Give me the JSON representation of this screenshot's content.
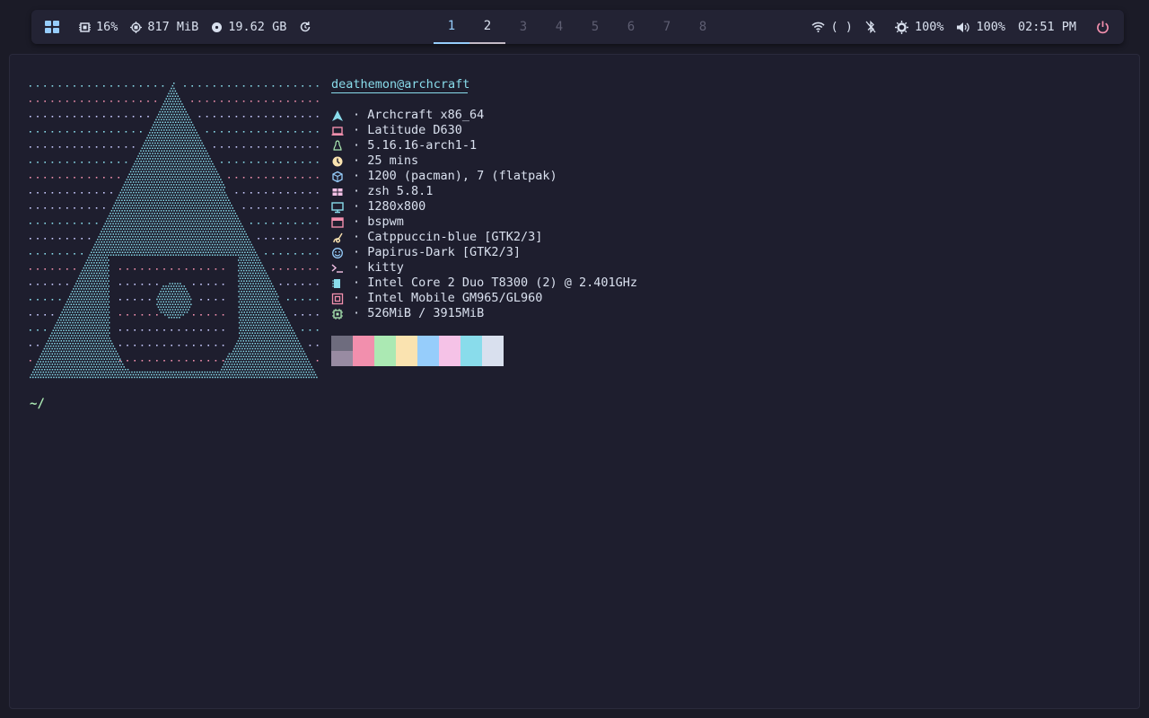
{
  "topbar": {
    "launcher_icon": "grid-icon",
    "cpu": "16%",
    "memory": "817 MiB",
    "disk": "19.62 GB",
    "workspaces": [
      "1",
      "2",
      "3",
      "4",
      "5",
      "6",
      "7",
      "8"
    ],
    "active_workspace": "1",
    "network": "( )",
    "brightness": "100%",
    "volume": "100%",
    "clock": "02:51 PM"
  },
  "terminal": {
    "user_host": "deathemon@archcraft",
    "info": [
      {
        "icon": "arch-logo-icon",
        "color": "#89dceb",
        "value": "Archcraft x86_64"
      },
      {
        "icon": "laptop-icon",
        "color": "#f28fad",
        "value": "Latitude D630"
      },
      {
        "icon": "linux-penguin-icon",
        "color": "#abe9b3",
        "value": "5.16.16-arch1-1"
      },
      {
        "icon": "clock-icon",
        "color": "#fae3b0",
        "value": "25 mins"
      },
      {
        "icon": "package-icon",
        "color": "#96cdfb",
        "value": "1200 (pacman), 7 (flatpak)"
      },
      {
        "icon": "shell-icon",
        "color": "#f5c2e7",
        "value": "zsh 5.8.1"
      },
      {
        "icon": "monitor-icon",
        "color": "#89dceb",
        "value": "1280x800"
      },
      {
        "icon": "window-icon",
        "color": "#f28fad",
        "value": "bspwm"
      },
      {
        "icon": "paint-icon",
        "color": "#fae3b0",
        "value": "Catppuccin-blue [GTK2/3]"
      },
      {
        "icon": "smiley-icon",
        "color": "#96cdfb",
        "value": "Papirus-Dark [GTK2/3]"
      },
      {
        "icon": "terminal-icon",
        "color": "#f5c2e7",
        "value": "kitty"
      },
      {
        "icon": "cpu-chip-icon",
        "color": "#89dceb",
        "value": "Intel Core 2 Duo T8300 (2) @ 2.401GHz"
      },
      {
        "icon": "gpu-icon",
        "color": "#f28fad",
        "value": "Intel Mobile GM965/GL960"
      },
      {
        "icon": "memory-icon",
        "color": "#abe9b3",
        "value": "526MiB / 3915MiB"
      }
    ],
    "palette_top": [
      "#6e6c7e",
      "#f28fad",
      "#abe9b3",
      "#fae3b0",
      "#96cdfb",
      "#f5c2e7",
      "#89dceb",
      "#d9e0ee"
    ],
    "palette_bottom": [
      "#988ba2",
      "#f28fad",
      "#abe9b3",
      "#fae3b0",
      "#96cdfb",
      "#f5c2e7",
      "#89dceb",
      "#d9e0ee"
    ],
    "prompt": "~/"
  },
  "colors": {
    "accent": "#96cdfb",
    "power": "#f28fad",
    "art_dots_cyan": "#89dceb",
    "art_dots_pink": "#f28fad",
    "art_dots_white": "#c9cbff"
  }
}
